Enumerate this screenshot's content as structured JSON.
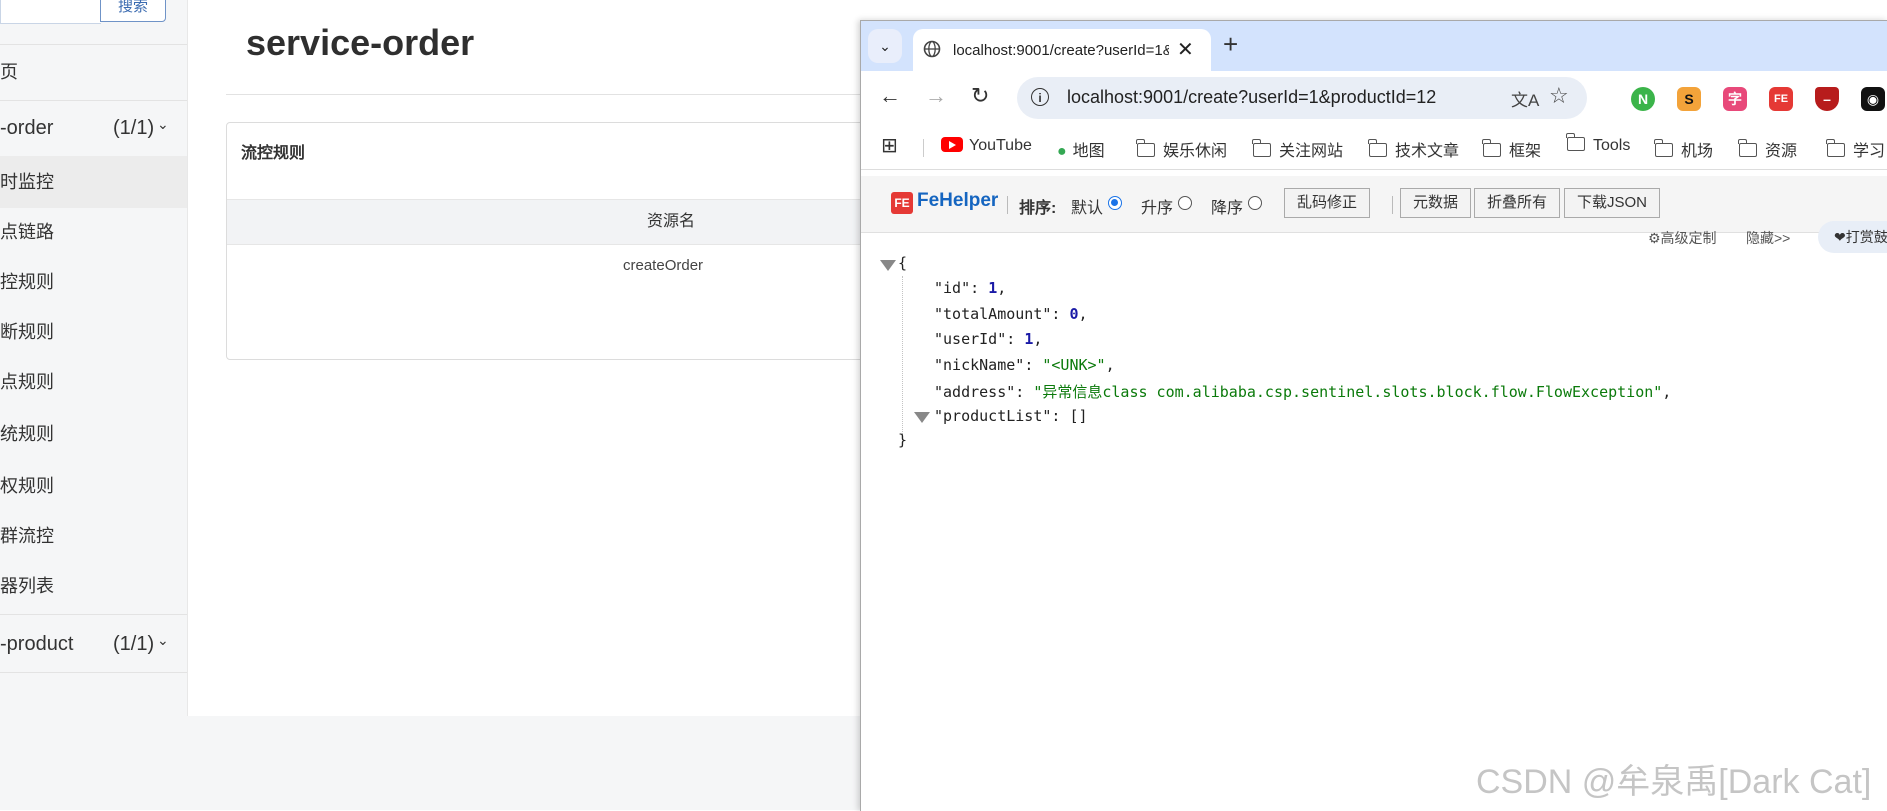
{
  "sentinel": {
    "search_button": "搜索",
    "home_item": "页",
    "apps": [
      {
        "name": "-order",
        "count": "(1/1)"
      },
      {
        "name": "-product",
        "count": "(1/1)"
      }
    ],
    "menu": [
      "时监控",
      "点链路",
      "控规则",
      "断规则",
      "点规则",
      "统规则",
      "权规则",
      "群流控",
      "器列表"
    ],
    "page_title": "service-order",
    "panel_title": "流控规则",
    "table_header": "资源名",
    "table_cell": "createOrder"
  },
  "browser": {
    "tab_title": "localhost:9001/create?userId=1&",
    "url": "localhost:9001/create?userId=1&productId=12",
    "bookmarks": [
      "YouTube",
      "地图",
      "娱乐休闲",
      "关注网站",
      "技术文章",
      "框架",
      "Tools",
      "机场",
      "资源",
      "学习"
    ],
    "extensions": [
      {
        "icon": "node-icon",
        "color": "#3bb44a"
      },
      {
        "icon": "s-icon",
        "color": "#2a2a2a"
      },
      {
        "icon": "translate-ext-icon",
        "color": "#e8497a"
      },
      {
        "icon": "fehelper-icon",
        "color": "#e53935"
      },
      {
        "icon": "shield-icon",
        "color": "#b71c1c"
      },
      {
        "icon": "panda-icon",
        "color": "#111111"
      }
    ]
  },
  "fehelper": {
    "brand": "FeHelper",
    "sort_label": "排序:",
    "sort_default": "默认",
    "sort_asc": "升序",
    "sort_desc": "降序",
    "fix_encoding": "乱码修正",
    "raw": "元数据",
    "collapse_all": "折叠所有",
    "download_json": "下载JSON",
    "advanced": "⚙高级定制",
    "hide": "隐藏>>",
    "donate": "❤打赏鼓励"
  },
  "json": {
    "id": "1",
    "totalAmount": "0",
    "userId": "1",
    "nickName": "\"<UNK>\"",
    "address": "\"异常信息class com.alibaba.csp.sentinel.slots.block.flow.FlowException\"",
    "productList": "[]"
  },
  "watermark": "CSDN @牟泉禹[Dark Cat]"
}
